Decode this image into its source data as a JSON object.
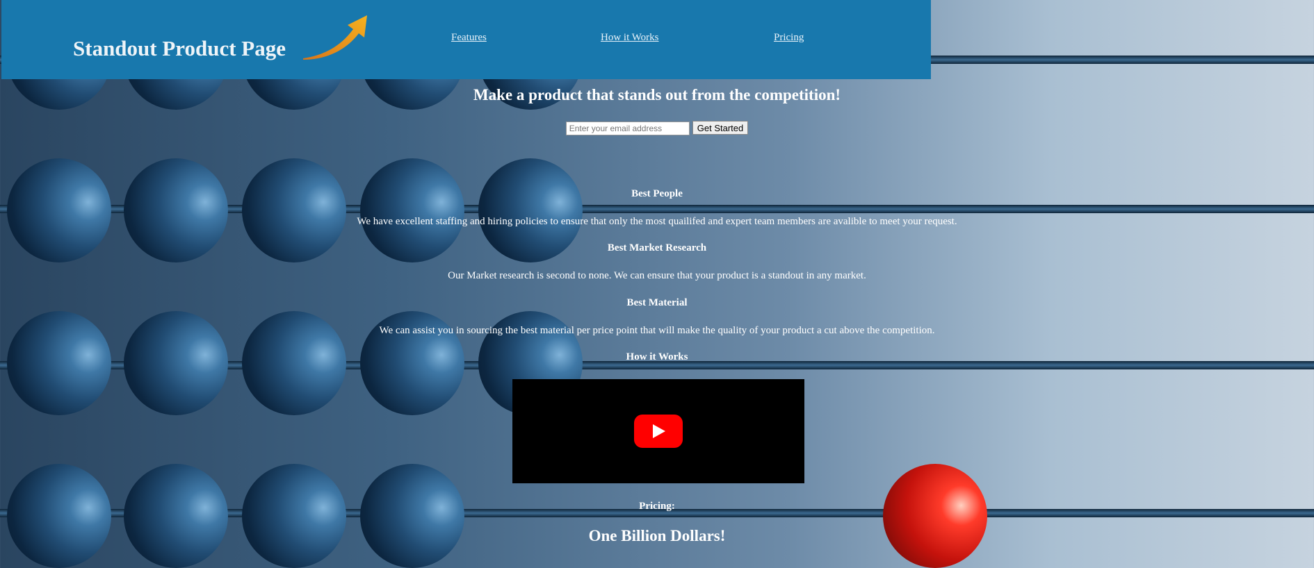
{
  "header": {
    "logo": "Standout Product Page",
    "nav": {
      "features": "Features",
      "how_it_works": "How it Works",
      "pricing": "Pricing"
    }
  },
  "hero": {
    "title": "Make a product that stands out from the competition!",
    "email_placeholder": "Enter your email address",
    "cta_label": "Get Started"
  },
  "features": [
    {
      "title": "Best People",
      "text": "We have excellent staffing and hiring policies to ensure that only the most quailifed and expert team members are avalible to meet your request."
    },
    {
      "title": "Best Market Research",
      "text": "Our Market research is second to none. We can ensure that your product is a standout in any market."
    },
    {
      "title": "Best Material",
      "text": "We can assist you in sourcing the best material per price point that will make the quality of your product a cut above the competition."
    }
  ],
  "how_it_works": {
    "title": "How it Works",
    "video_icon": "youtube-play-icon"
  },
  "pricing": {
    "title": "Pricing:",
    "value": "One Billion Dollars!"
  },
  "colors": {
    "header_bg": "#1878ad",
    "arrow": "#f0a020",
    "youtube_red": "#ff0000"
  }
}
